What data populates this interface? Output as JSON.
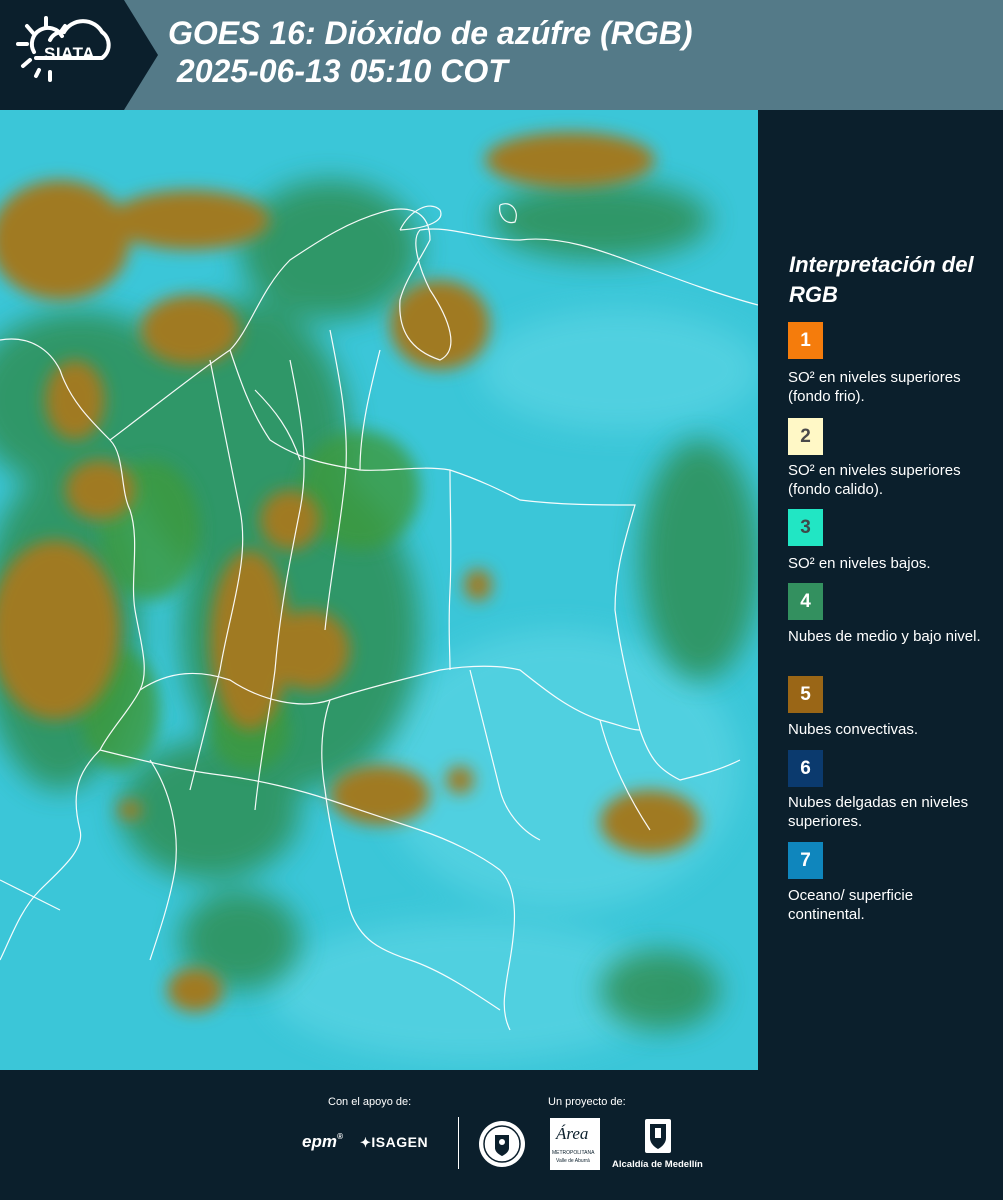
{
  "header": {
    "logo_text": "SIATA",
    "title_line1": "GOES 16: Dióxido de azúfre (RGB)",
    "title_line2": " 2025-06-13 05:10 COT",
    "bg_color": "#547a88",
    "dark_color": "#0b1f2c"
  },
  "map": {
    "icon": "satellite-imagery",
    "colors": {
      "ocean": "#3bc6d8",
      "low_cloud": "#2f8f55",
      "convective": "#a07a22",
      "border": "#ffffff"
    }
  },
  "legend": {
    "title": "Interpretación del RGB",
    "items": [
      {
        "number": "1",
        "color": "#f57c0c",
        "text_color": "#ffffff",
        "label": "SO² en niveles superiores (fondo frio)."
      },
      {
        "number": "2",
        "color": "#fff8c6",
        "text_color": "#4a4a4a",
        "label": "SO² en niveles superiores (fondo calido)."
      },
      {
        "number": "3",
        "color": "#21e6c4",
        "text_color": "#3d4a4a",
        "label": "SO² en niveles bajos."
      },
      {
        "number": "4",
        "color": "#33905f",
        "text_color": "#ffffff",
        "label": "Nubes de medio y bajo nivel."
      },
      {
        "number": "5",
        "color": "#9a6616",
        "text_color": "#ffffff",
        "label": "Nubes convectivas."
      },
      {
        "number": "6",
        "color": "#0b3a6e",
        "text_color": "#ffffff",
        "label": "Nubes delgadas en niveles superiores."
      },
      {
        "number": "7",
        "color": "#0f86bd",
        "text_color": "#ffffff",
        "label": "Oceano/ superficie continental."
      }
    ]
  },
  "footer": {
    "support_label": "Con el apoyo de:",
    "project_label": "Un proyecto de:",
    "sponsors": [
      "epm",
      "ISAGEN"
    ],
    "partners": {
      "area_name": "Área",
      "area_sub1": "METROPOLITANA",
      "area_sub2": "Valle de Aburrá",
      "alcaldia": "Alcaldía de Medellín"
    },
    "icons": [
      "epm-logo-icon",
      "isagen-logo-icon",
      "medellin-seal-icon",
      "area-metropolitana-logo-icon",
      "alcaldia-shield-icon"
    ]
  }
}
